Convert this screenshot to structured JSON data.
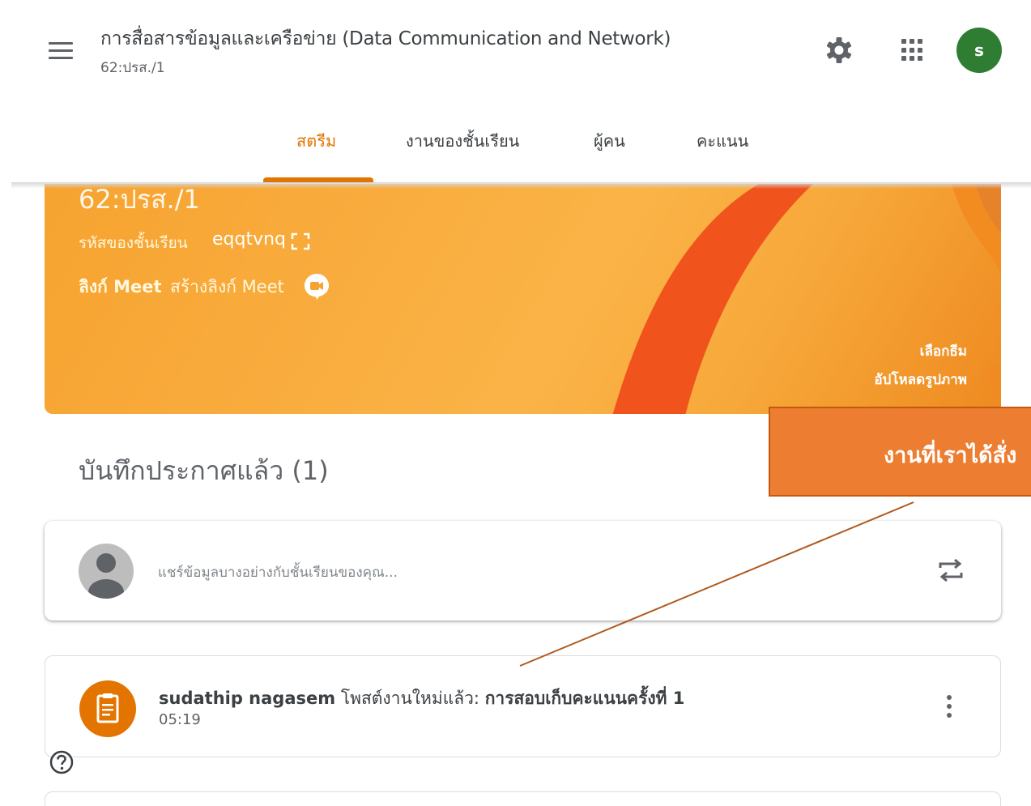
{
  "header": {
    "class_title": "การสื่อสารข้อมูลและเครือข่าย (Data Communication and Network)",
    "class_section": "62:ปรส./1",
    "menu_icon": "hamburger-menu-icon",
    "settings_icon": "gear-icon",
    "apps_icon": "apps-grid-icon",
    "account_initial": "s"
  },
  "tabs": [
    {
      "label": "สตรีม",
      "active": true
    },
    {
      "label": "งานของชั้นเรียน",
      "active": false
    },
    {
      "label": "ผู้คน",
      "active": false
    },
    {
      "label": "คะแนน",
      "active": false
    }
  ],
  "banner": {
    "class_name": "62:ปรส./1",
    "class_code_label": "รหัสของชั้นเรียน",
    "class_code": "eqqtvnq",
    "meet_label": "ลิงก์ Meet",
    "meet_create": "สร้างลิงก์ Meet",
    "select_theme": "เลือกธีม",
    "upload_photo": "อัปโหลดรูปภาพ"
  },
  "stream": {
    "saved_heading": "บันทึกประกาศแล้ว (1)",
    "share_placeholder": "แชร์ข้อมูลบางอย่างกับชั้นเรียนของคุณ...",
    "post": {
      "author": "sudathip nagasem",
      "action": " โพสต์งานใหม่แล้ว: ",
      "title": "การสอบเก็บคะแนนครั้งที่ 1",
      "time": "05:19"
    }
  },
  "annotation": {
    "callout_text": "งานที่เราได้สั่ง",
    "color": "#ed7d31",
    "line_color": "#b05a1e"
  },
  "colors": {
    "accent": "#e37400",
    "avatar_green": "#2e7d32",
    "banner_orange": "#f6a330"
  }
}
